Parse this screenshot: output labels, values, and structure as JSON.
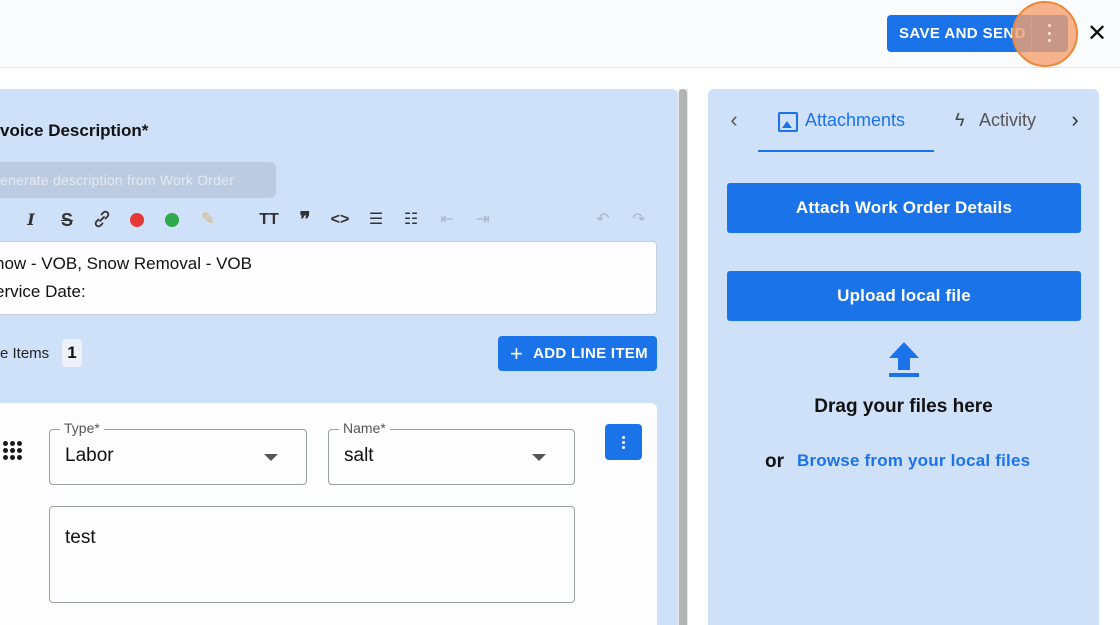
{
  "header": {
    "save_label": "SAVE AND SEND",
    "more_icon": "more-vert-icon",
    "close_icon": "close-icon",
    "accent_color": "#1a73e8"
  },
  "invoice": {
    "description_title": "voice Description*",
    "generate_label": "enerate description from Work Order",
    "toolbar": [
      "italic-icon",
      "strikethrough-icon",
      "link-icon",
      "red-color-icon",
      "green-color-icon",
      "highlight-pencil-icon",
      "text-size-icon",
      "quote-icon",
      "code-icon",
      "bullet-list-icon",
      "numbered-list-icon",
      "outdent-icon",
      "indent-icon",
      "undo-icon",
      "redo-icon"
    ],
    "description_lines": [
      "now - VOB, Snow Removal - VOB",
      "ervice Date:"
    ]
  },
  "line_items": {
    "label": "e Items",
    "count": "1",
    "add_label": "ADD LINE ITEM",
    "item": {
      "type_label": "Type*",
      "type_value": "Labor",
      "name_label": "Name*",
      "name_value": "salt",
      "notes_value": "test"
    }
  },
  "side_panel": {
    "tabs": [
      {
        "label": "Attachments",
        "icon": "image-icon",
        "active": true
      },
      {
        "label": "Activity",
        "icon": "bolt-icon",
        "active": false
      }
    ],
    "attach_wo_label": "Attach Work Order Details",
    "upload_label": "Upload local file",
    "drag_text": "Drag your files here",
    "or_text": "or",
    "browse_label": "Browse from your local files"
  }
}
